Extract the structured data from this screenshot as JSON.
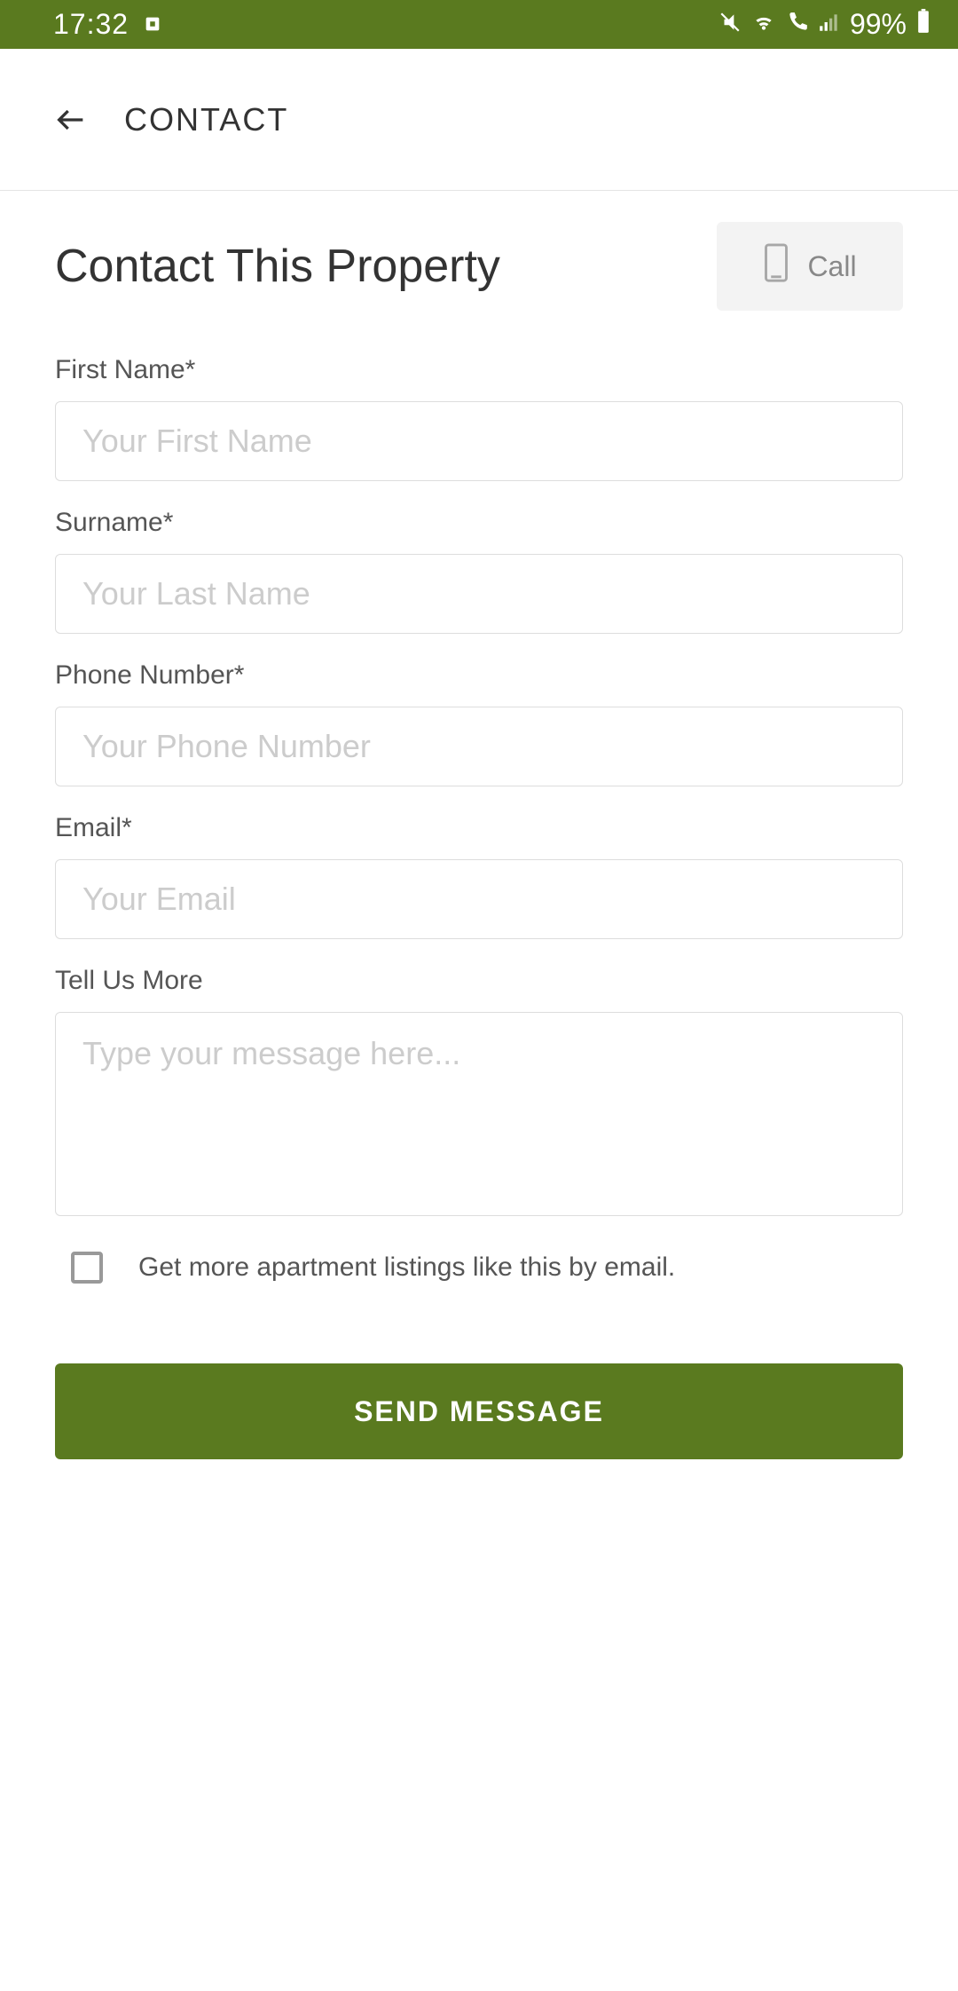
{
  "statusBar": {
    "time": "17:32",
    "battery": "99%"
  },
  "header": {
    "title": "CONTACT"
  },
  "page": {
    "title": "Contact This Property",
    "callLabel": "Call"
  },
  "fields": {
    "firstName": {
      "label": "First Name*",
      "placeholder": "Your First Name"
    },
    "surname": {
      "label": "Surname*",
      "placeholder": "Your Last Name"
    },
    "phone": {
      "label": "Phone Number*",
      "placeholder": "Your Phone Number"
    },
    "email": {
      "label": "Email*",
      "placeholder": "Your Email"
    },
    "message": {
      "label": "Tell Us More",
      "placeholder": "Type your message here..."
    }
  },
  "checkbox": {
    "label": "Get more apartment listings like this by email."
  },
  "actions": {
    "send": "SEND MESSAGE"
  }
}
